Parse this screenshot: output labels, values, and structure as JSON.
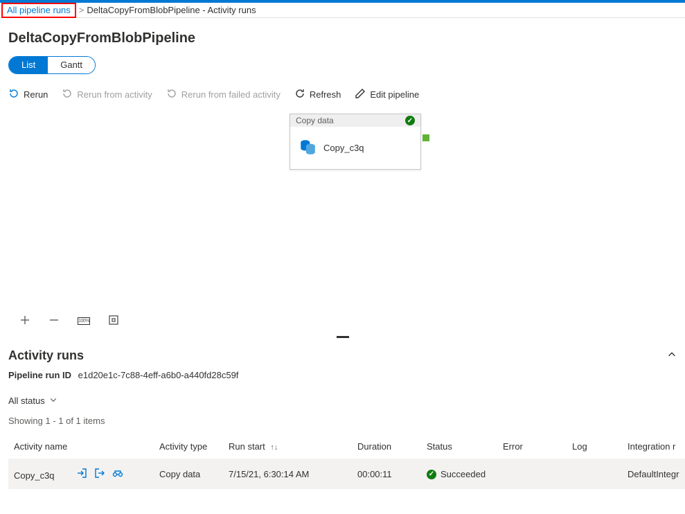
{
  "breadcrumb": {
    "link": "All pipeline runs",
    "current": "DeltaCopyFromBlobPipeline - Activity runs"
  },
  "page_title": "DeltaCopyFromBlobPipeline",
  "view_toggle": {
    "list": "List",
    "gantt": "Gantt"
  },
  "actions": {
    "rerun": "Rerun",
    "rerun_activity": "Rerun from activity",
    "rerun_failed": "Rerun from failed activity",
    "refresh": "Refresh",
    "edit": "Edit pipeline"
  },
  "node": {
    "type_label": "Copy data",
    "name": "Copy_c3q"
  },
  "zoom_label": "100%",
  "section": {
    "title": "Activity runs",
    "run_id_label": "Pipeline run ID",
    "run_id": "e1d20e1c-7c88-4eff-a6b0-a440fd28c59f",
    "filter": "All status",
    "count": "Showing 1 - 1 of 1 items"
  },
  "table": {
    "headers": {
      "name": "Activity name",
      "type": "Activity type",
      "start": "Run start",
      "duration": "Duration",
      "status": "Status",
      "error": "Error",
      "log": "Log",
      "integration": "Integration r"
    },
    "rows": [
      {
        "name": "Copy_c3q",
        "type": "Copy data",
        "start": "7/15/21, 6:30:14 AM",
        "duration": "00:00:11",
        "status": "Succeeded",
        "error": "",
        "log": "",
        "integration": "DefaultIntegr"
      }
    ]
  }
}
